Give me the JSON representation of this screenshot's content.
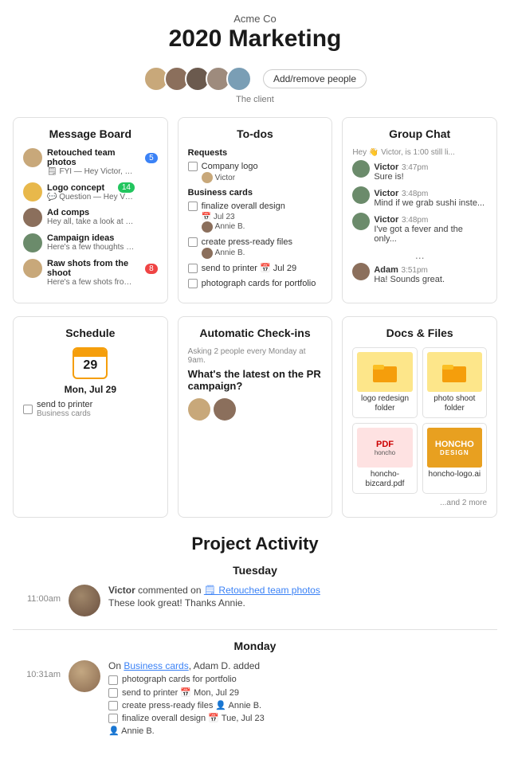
{
  "header": {
    "company": "Acme Co",
    "title": "2020 Marketing",
    "people_label": "The client",
    "add_people_btn": "Add/remove people"
  },
  "message_board": {
    "title": "Message Board",
    "items": [
      {
        "title": "Retouched team photos",
        "preview": "FYI — Hey Victor, here's",
        "badge": "5",
        "badge_color": "blue"
      },
      {
        "title": "Logo concept",
        "preview": "Question — Hey Victor,",
        "badge": "14",
        "badge_color": "green"
      },
      {
        "title": "Ad comps",
        "preview": "Hey all, take a look at these and",
        "badge": "",
        "badge_color": ""
      },
      {
        "title": "Campaign ideas",
        "preview": "Here's a few thoughts I had",
        "badge": "",
        "badge_color": ""
      },
      {
        "title": "Raw shots from the shoot",
        "preview": "Here's a few shots from the",
        "badge": "8",
        "badge_color": "red"
      }
    ]
  },
  "todos": {
    "title": "To-dos",
    "sections": [
      {
        "label": "Requests",
        "items": [
          {
            "text": "Company logo",
            "assign": "Victor",
            "checked": false,
            "due": ""
          }
        ]
      },
      {
        "label": "Business cards",
        "items": [
          {
            "text": "finalize overall design",
            "due": "Jul 23",
            "assign": "Annie B.",
            "checked": false
          },
          {
            "text": "create press-ready files",
            "due": "",
            "assign": "Annie B.",
            "checked": false
          },
          {
            "text": "send to printer",
            "due": "Jul 29",
            "assign": "",
            "checked": false
          },
          {
            "text": "photograph cards for portfolio",
            "due": "",
            "assign": "",
            "checked": false
          }
        ]
      }
    ]
  },
  "group_chat": {
    "title": "Group Chat",
    "preview": "Hey 👋 Victor, is 1:00 still li...",
    "messages": [
      {
        "author": "Victor",
        "time": "3:47pm",
        "msg": "Sure is!"
      },
      {
        "author": "Victor",
        "time": "3:48pm",
        "msg": "Mind if we grab sushi inste..."
      },
      {
        "author": "Victor",
        "time": "3:48pm",
        "msg": "I've got a fever and the only..."
      },
      {
        "author": "Adam",
        "time": "3:51pm",
        "msg": "Ha! Sounds great."
      }
    ]
  },
  "schedule": {
    "title": "Schedule",
    "date_label": "Mon, Jul 29",
    "todo_text": "send to printer",
    "todo_sub": "Business cards"
  },
  "auto_checkins": {
    "title": "Automatic Check-ins",
    "meta": "Asking 2 people every Monday at 9am.",
    "question": "What's the latest on the PR campaign?"
  },
  "docs_files": {
    "title": "Docs & Files",
    "items": [
      {
        "type": "folder",
        "label": "logo redesign folder"
      },
      {
        "type": "folder",
        "label": "photo shoot folder"
      },
      {
        "type": "pdf",
        "label": "honcho-bizcard.pdf"
      },
      {
        "type": "ai",
        "label": "honcho-logo.ai"
      }
    ],
    "more": "...and 2 more"
  },
  "activity": {
    "title": "Project Activity",
    "days": [
      {
        "label": "Tuesday",
        "items": [
          {
            "time": "11:00am",
            "author": "Victor",
            "action": "commented on",
            "link_text": "🗒 Retouched team photos",
            "body": "These look great! Thanks Annie."
          }
        ]
      },
      {
        "label": "Monday",
        "items": [
          {
            "time": "10:31am",
            "author": "Adam D.",
            "action": "On",
            "link_text": "Business cards",
            "suffix": ", Adam D. added",
            "todos": [
              "photograph cards for portfolio",
              "send to printer 📅 Mon, Jul 29",
              "create press-ready files 👤 Annie B.",
              "finalize overall design 📅 Tue, Jul 23",
              "👤 Annie B."
            ]
          }
        ]
      }
    ]
  }
}
